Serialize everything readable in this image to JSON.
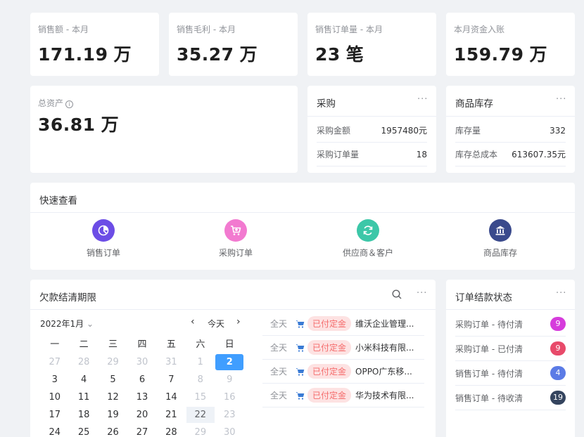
{
  "stats": [
    {
      "label": "销售额 - 本月",
      "value": "171.19",
      "unit": "万"
    },
    {
      "label": "销售毛利 - 本月",
      "value": "35.27",
      "unit": "万"
    },
    {
      "label": "销售订单量 - 本月",
      "value": "23",
      "unit": "笔"
    },
    {
      "label": "本月资金入账",
      "value": "159.79",
      "unit": "万"
    }
  ],
  "assets": {
    "label": "总资产",
    "info": "i",
    "value": "36.81",
    "unit": "万"
  },
  "purchase": {
    "title": "采购",
    "more": "···",
    "rows": [
      {
        "label": "采购金额",
        "value": "1957480元"
      },
      {
        "label": "采购订单量",
        "value": "18"
      }
    ]
  },
  "inventory": {
    "title": "商品库存",
    "more": "···",
    "rows": [
      {
        "label": "库存量",
        "value": "332"
      },
      {
        "label": "库存总成本",
        "value": "613607.35元"
      }
    ]
  },
  "quick": {
    "title": "快速查看",
    "items": [
      {
        "label": "销售订单",
        "icon": "pie-chart-icon",
        "color": "#6c4de6"
      },
      {
        "label": "采购订单",
        "icon": "cart-icon",
        "color": "#f27ad0"
      },
      {
        "label": "供应商＆客户",
        "icon": "refresh-icon",
        "color": "#3cc7a8"
      },
      {
        "label": "商品库存",
        "icon": "bank-icon",
        "color": "#3a4a8c"
      }
    ]
  },
  "debt": {
    "title": "欠款结清期限",
    "more": "···",
    "calendar": {
      "month": "2022年1月",
      "chevron": "⌄",
      "prev": "‹",
      "today": "今天",
      "next": "›",
      "weekdays": [
        "一",
        "二",
        "三",
        "四",
        "五",
        "六",
        "日"
      ],
      "weeks": [
        [
          "27",
          "28",
          "29",
          "30",
          "31",
          "1",
          "2"
        ],
        [
          "3",
          "4",
          "5",
          "6",
          "7",
          "8",
          "9"
        ],
        [
          "10",
          "11",
          "12",
          "13",
          "14",
          "15",
          "16"
        ],
        [
          "17",
          "18",
          "19",
          "20",
          "21",
          "22",
          "23"
        ],
        [
          "24",
          "25",
          "26",
          "27",
          "28",
          "29",
          "30"
        ]
      ]
    },
    "transactions": [
      {
        "all": "全天",
        "badge": "已付定金",
        "name": "维沃企业管理..."
      },
      {
        "all": "全天",
        "badge": "已付定金",
        "name": "小米科技有限..."
      },
      {
        "all": "全天",
        "badge": "已付定金",
        "name": "OPPO广东移..."
      },
      {
        "all": "全天",
        "badge": "已付定金",
        "name": "华为技术有限..."
      }
    ]
  },
  "order_status": {
    "title": "订单结款状态",
    "more": "···",
    "rows": [
      {
        "label": "采购订单 - 待付清",
        "count": "9",
        "color": "#d63cdc"
      },
      {
        "label": "采购订单 - 已付清",
        "count": "9",
        "color": "#e84a6a"
      },
      {
        "label": "销售订单 - 待付清",
        "count": "4",
        "color": "#5b7be6"
      },
      {
        "label": "销售订单 - 待收清",
        "count": "19",
        "color": "#34445e"
      }
    ]
  }
}
